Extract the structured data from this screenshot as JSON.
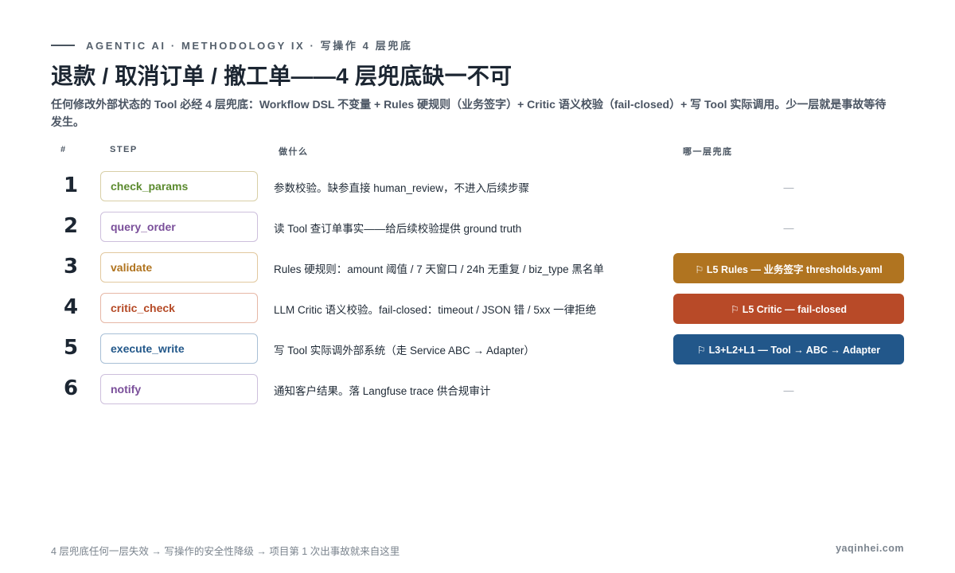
{
  "eyebrow": "AGENTIC AI · METHODOLOGY IX · 写操作 4 层兜底",
  "title": "退款 / 取消订单 / 撤工单——4 层兜底缺一不可",
  "subtitle": "任何修改外部状态的 Tool 必经 4 层兜底：Workflow DSL 不变量 + Rules 硬规则（业务签字）+ Critic 语义校验（fail-closed）+ 写 Tool 实际调用。少一层就是事故等待发生。",
  "table": {
    "headers": {
      "num": "#",
      "step": "STEP",
      "what": "做什么",
      "layer": "哪一层兜底"
    },
    "rows": [
      {
        "num": "1",
        "step": "check_params",
        "step_color": "#5b8a2e",
        "step_border": "#d8cfa6",
        "desc": "参数校验。缺参直接 human_review，不进入后续步骤",
        "layer": "—",
        "layer_color": ""
      },
      {
        "num": "2",
        "step": "query_order",
        "step_color": "#7a4f9a",
        "step_border": "#cdbfdc",
        "desc": "读 Tool 查订单事实——给后续校验提供 ground truth",
        "layer": "—",
        "layer_color": ""
      },
      {
        "num": "3",
        "step": "validate",
        "step_color": "#b0741f",
        "step_border": "#e2c89e",
        "desc": "Rules 硬规则：amount 阈值 / 7 天窗口 / 24h 无重复 / biz_type 黑名单",
        "layer": "⚐ L5 Rules — 业务签字 thresholds.yaml",
        "layer_color": "#b07420"
      },
      {
        "num": "4",
        "step": "critic_check",
        "step_color": "#b54a26",
        "step_border": "#e6b7a6",
        "desc": "LLM Critic 语义校验。fail-closed：timeout / JSON 错 / 5xx 一律拒绝",
        "layer": "⚐ L5 Critic — fail-closed",
        "layer_color": "#b84a28"
      },
      {
        "num": "5",
        "step": "execute_write",
        "step_color": "#23588a",
        "step_border": "#a8bfd6",
        "desc": "写 Tool 实际调外部系统（走 Service ABC → Adapter）",
        "layer": "⚐ L3+L2+L1 — Tool → ABC → Adapter",
        "layer_color": "#22578a"
      },
      {
        "num": "6",
        "step": "notify",
        "step_color": "#7a4f9a",
        "step_border": "#cdbfdc",
        "desc": "通知客户结果。落 Langfuse trace 供合规审计",
        "layer": "—",
        "layer_color": ""
      }
    ]
  },
  "footer": {
    "note": "4 层兜底任何一层失效 → 写操作的安全性降级 → 项目第 1 次出事故就来自这里",
    "site": "yaqinhei.com"
  }
}
